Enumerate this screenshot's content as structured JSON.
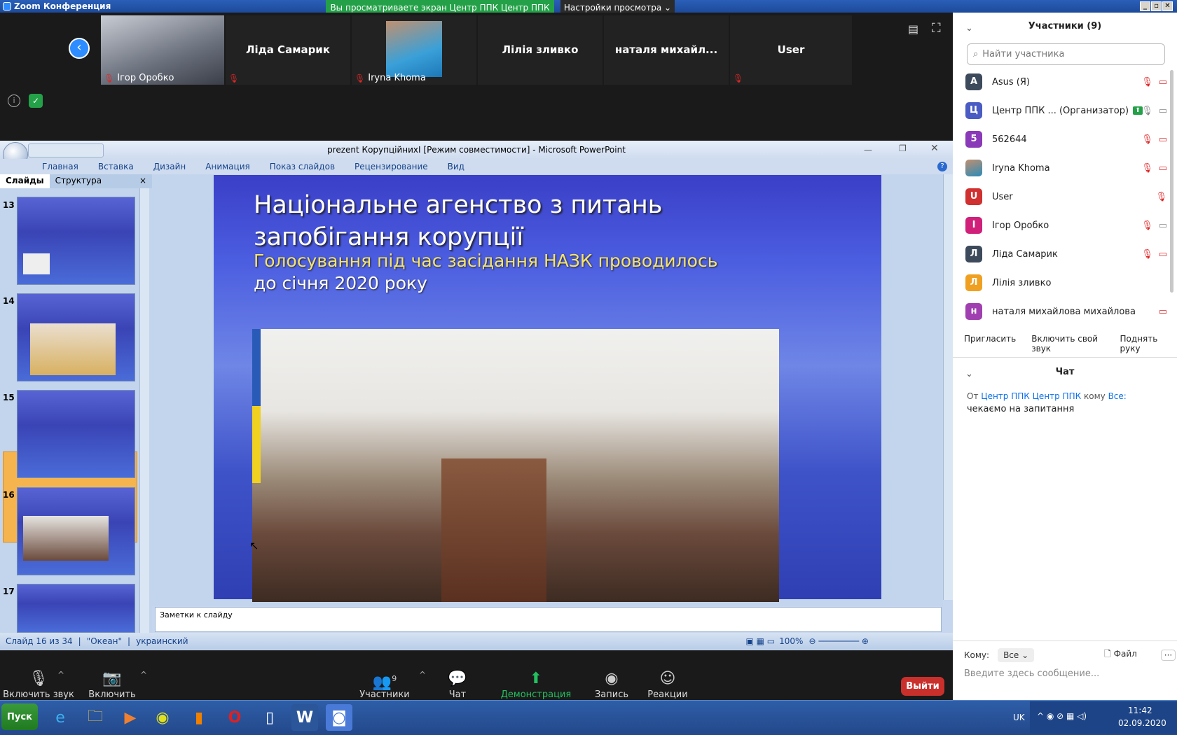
{
  "window": {
    "title": "Zoom Конференция"
  },
  "banner": {
    "viewing": "Вы просматриваете экран Центр ППК Центр ППК",
    "view_options": "Настройки просмотра"
  },
  "strip": {
    "tiles": [
      {
        "name": "Ігор Оробко"
      },
      {
        "name": "Ліда Самарик"
      },
      {
        "name": "Iryna Khoma"
      },
      {
        "name": "Лілія зливко"
      },
      {
        "name": "наталя  михайл..."
      },
      {
        "name": "User"
      }
    ]
  },
  "ppt": {
    "title": "prezent КорупційнихІ [Режим совместимости] - Microsoft PowerPoint",
    "menu": [
      "Главная",
      "Вставка",
      "Дизайн",
      "Анимация",
      "Показ слайдов",
      "Рецензирование",
      "Вид"
    ],
    "panel_tabs": [
      "Слайды",
      "Структура"
    ],
    "slide_numbers": [
      "13",
      "14",
      "15",
      "16",
      "17"
    ],
    "slide": {
      "title": "Національне агенство з питань запобігання корупції",
      "subtitle_yellow": "Голосування під час засідання НАЗК проводилось",
      "subtitle_white": "до січня 2020 року"
    },
    "notes": "Заметки к слайду",
    "status": {
      "slide": "Слайд 16 из 34",
      "theme": "\"Океан\"",
      "lang": "украинский",
      "zoom": "100%"
    }
  },
  "toolbar": {
    "mic": "Включить звук",
    "video": "Включить видео",
    "participants": "Участники",
    "participants_count": "9",
    "chat": "Чат",
    "share": "Демонстрация экрана",
    "record": "Запись",
    "reactions": "Реакции",
    "leave": "Выйти"
  },
  "participants": {
    "header": "Участники (9)",
    "search_placeholder": "Найти участника",
    "list": [
      {
        "initial": "A",
        "name": "Asus (Я)",
        "color": "#3c4a5c"
      },
      {
        "initial": "Ц",
        "name": "Центр ППК ... (Организатор)",
        "color": "#4a5cc4"
      },
      {
        "initial": "5",
        "name": "562644",
        "color": "#8a3ab8"
      },
      {
        "initial": "I",
        "name": "Iryna Khoma",
        "color": "#2a8ab8"
      },
      {
        "initial": "U",
        "name": "User",
        "color": "#d03030"
      },
      {
        "initial": "І",
        "name": "Ігор Оробко",
        "color": "#d0207a"
      },
      {
        "initial": "Л",
        "name": "Ліда Самарик",
        "color": "#3c4a5c"
      },
      {
        "initial": "Л",
        "name": "Лілія зливко",
        "color": "#f0a020"
      },
      {
        "initial": "н",
        "name": "наталя михайлова михайлова",
        "color": "#a040b0"
      }
    ],
    "buttons": [
      "Пригласить",
      "Включить свой звук",
      "Поднять руку"
    ]
  },
  "chat": {
    "header": "Чат",
    "from_prefix": "От",
    "from": "Центр ППК Центр ППК",
    "to_prefix": "кому",
    "to": "Все:",
    "message": "чекаємо на запитання",
    "to_label": "Кому:",
    "to_value": "Все",
    "file": "Файл",
    "input_placeholder": "Введите здесь сообщение..."
  },
  "taskbar": {
    "start": "Пуск",
    "lang": "UK",
    "time": "11:42",
    "date": "02.09.2020"
  }
}
